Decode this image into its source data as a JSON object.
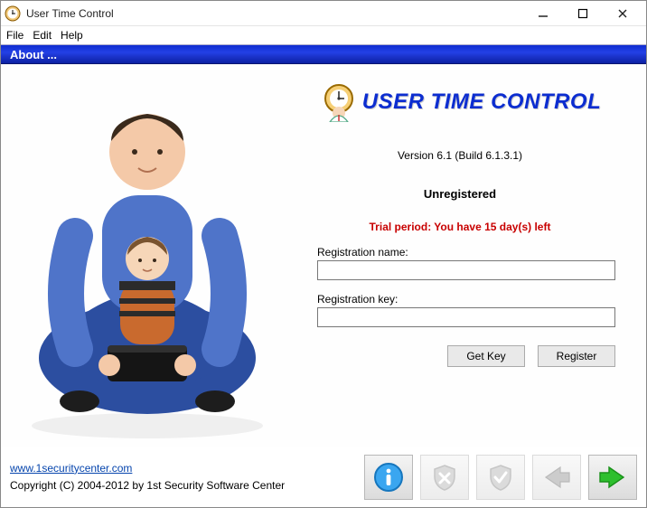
{
  "window": {
    "title": "User Time Control"
  },
  "menu": {
    "file": "File",
    "edit": "Edit",
    "help": "Help"
  },
  "header": {
    "title": "About ..."
  },
  "logo": {
    "text": "USER TIME CONTROL"
  },
  "about": {
    "version": "Version 6.1 (Build 6.1.3.1)",
    "status": "Unregistered",
    "trial": "Trial period: You have 15 day(s) left"
  },
  "form": {
    "name_label": "Registration name:",
    "name_value": "",
    "key_label": "Registration key:",
    "key_value": "",
    "getkey_btn": "Get Key",
    "register_btn": "Register"
  },
  "footer": {
    "url": "www.1securitycenter.com",
    "copyright": "Copyright (C) 2004-2012 by 1st Security Software Center"
  },
  "nav": {
    "info": "info",
    "shield_off": "shield-off",
    "shield_on": "shield-on",
    "back": "back",
    "next": "next"
  }
}
